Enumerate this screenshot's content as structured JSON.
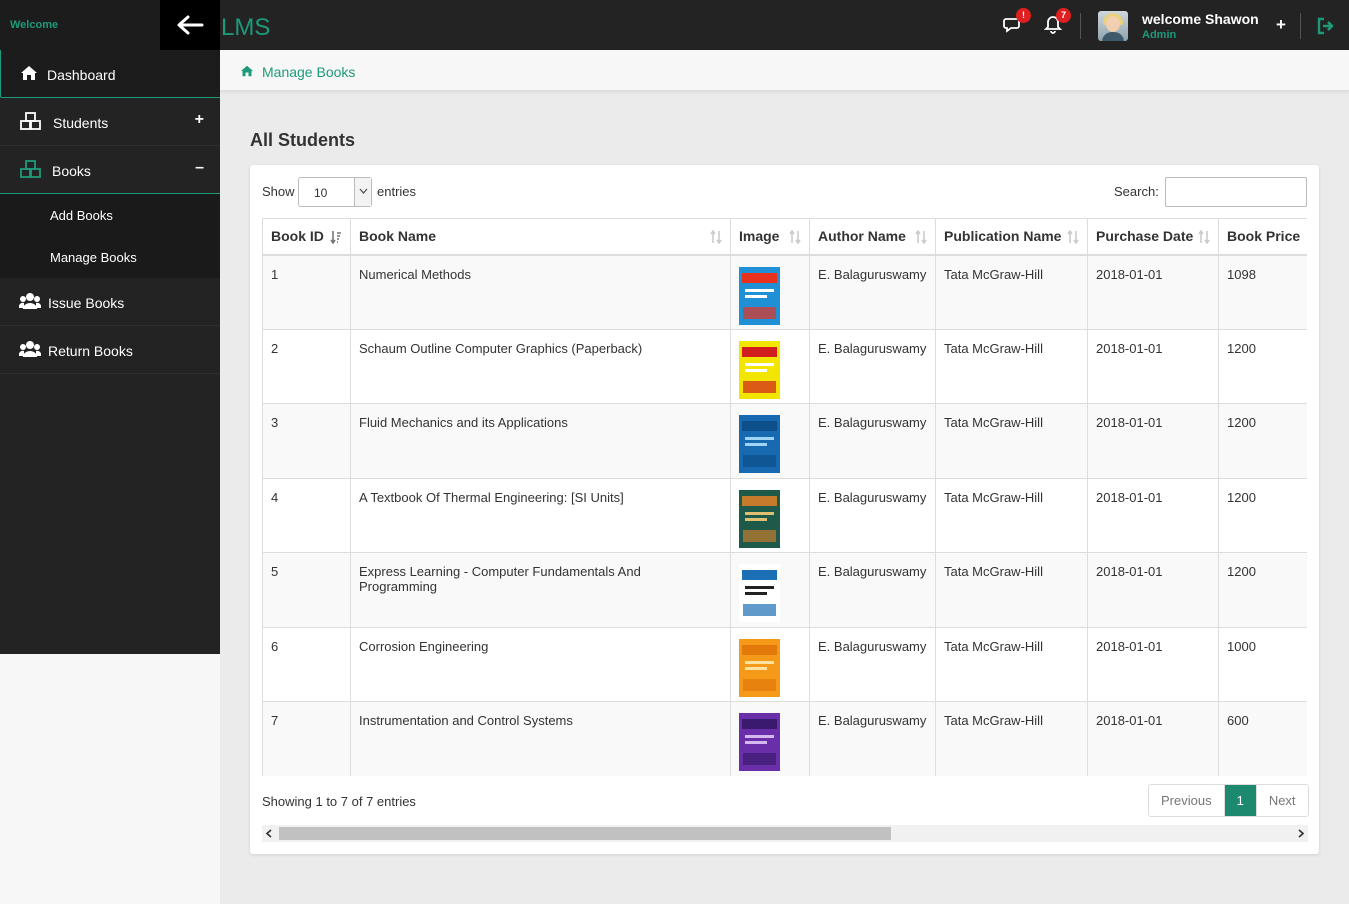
{
  "topbar": {
    "welcome_text": "Welcome",
    "app_name": "LMS",
    "messages_count": "!",
    "notifications_count": "7",
    "user_greeting": "welcome Shawon",
    "user_role": "Admin",
    "plus_label": "+"
  },
  "sidebar": {
    "items": [
      {
        "label": "Dashboard",
        "icon": "home-icon"
      },
      {
        "label": "Students",
        "icon": "cubes-icon",
        "toggle": "+"
      },
      {
        "label": "Books",
        "icon": "cubes-icon",
        "toggle": "–"
      },
      {
        "label": "Issue Books",
        "icon": "users-icon"
      },
      {
        "label": "Return Books",
        "icon": "users-icon"
      }
    ],
    "books_submenu": [
      {
        "label": "Add Books"
      },
      {
        "label": "Manage Books"
      }
    ]
  },
  "breadcrumb": {
    "label": "Manage Books"
  },
  "page_title": "All Students",
  "table_controls": {
    "show_label": "Show",
    "show_value": "10",
    "entries_label": "entries",
    "search_label": "Search:",
    "search_value": ""
  },
  "table": {
    "columns": [
      "Book ID",
      "Book Name",
      "Image",
      "Author Name",
      "Publication Name",
      "Purchase Date",
      "Book Price"
    ],
    "rows": [
      {
        "id": "1",
        "name": "Numerical Methods",
        "author": "E. Balaguruswamy",
        "publication": "Tata McGraw-Hill",
        "date": "2018-01-01",
        "price": "1098"
      },
      {
        "id": "2",
        "name": "Schaum Outline Computer Graphics (Paperback)",
        "author": "E. Balaguruswamy",
        "publication": "Tata McGraw-Hill",
        "date": "2018-01-01",
        "price": "1200"
      },
      {
        "id": "3",
        "name": "Fluid Mechanics and its Applications",
        "author": "E. Balaguruswamy",
        "publication": "Tata McGraw-Hill",
        "date": "2018-01-01",
        "price": "1200"
      },
      {
        "id": "4",
        "name": "A Textbook Of Thermal Engineering: [SI Units]",
        "author": "E. Balaguruswamy",
        "publication": "Tata McGraw-Hill",
        "date": "2018-01-01",
        "price": "1200"
      },
      {
        "id": "5",
        "name": "Express Learning - Computer Fundamentals And Programming",
        "author": "E. Balaguruswamy",
        "publication": "Tata McGraw-Hill",
        "date": "2018-01-01",
        "price": "1200"
      },
      {
        "id": "6",
        "name": "Corrosion Engineering",
        "author": "E. Balaguruswamy",
        "publication": "Tata McGraw-Hill",
        "date": "2018-01-01",
        "price": "1000"
      },
      {
        "id": "7",
        "name": "Instrumentation and Control Systems",
        "author": "E. Balaguruswamy",
        "publication": "Tata McGraw-Hill",
        "date": "2018-01-01",
        "price": "600"
      }
    ]
  },
  "footer": {
    "info": "Showing 1 to 7 of 7 entries",
    "previous": "Previous",
    "current_page": "1",
    "next": "Next"
  },
  "colors": {
    "accent": "#1d9a7a",
    "sidebar_bg": "#232323",
    "badge": "#e02020"
  }
}
